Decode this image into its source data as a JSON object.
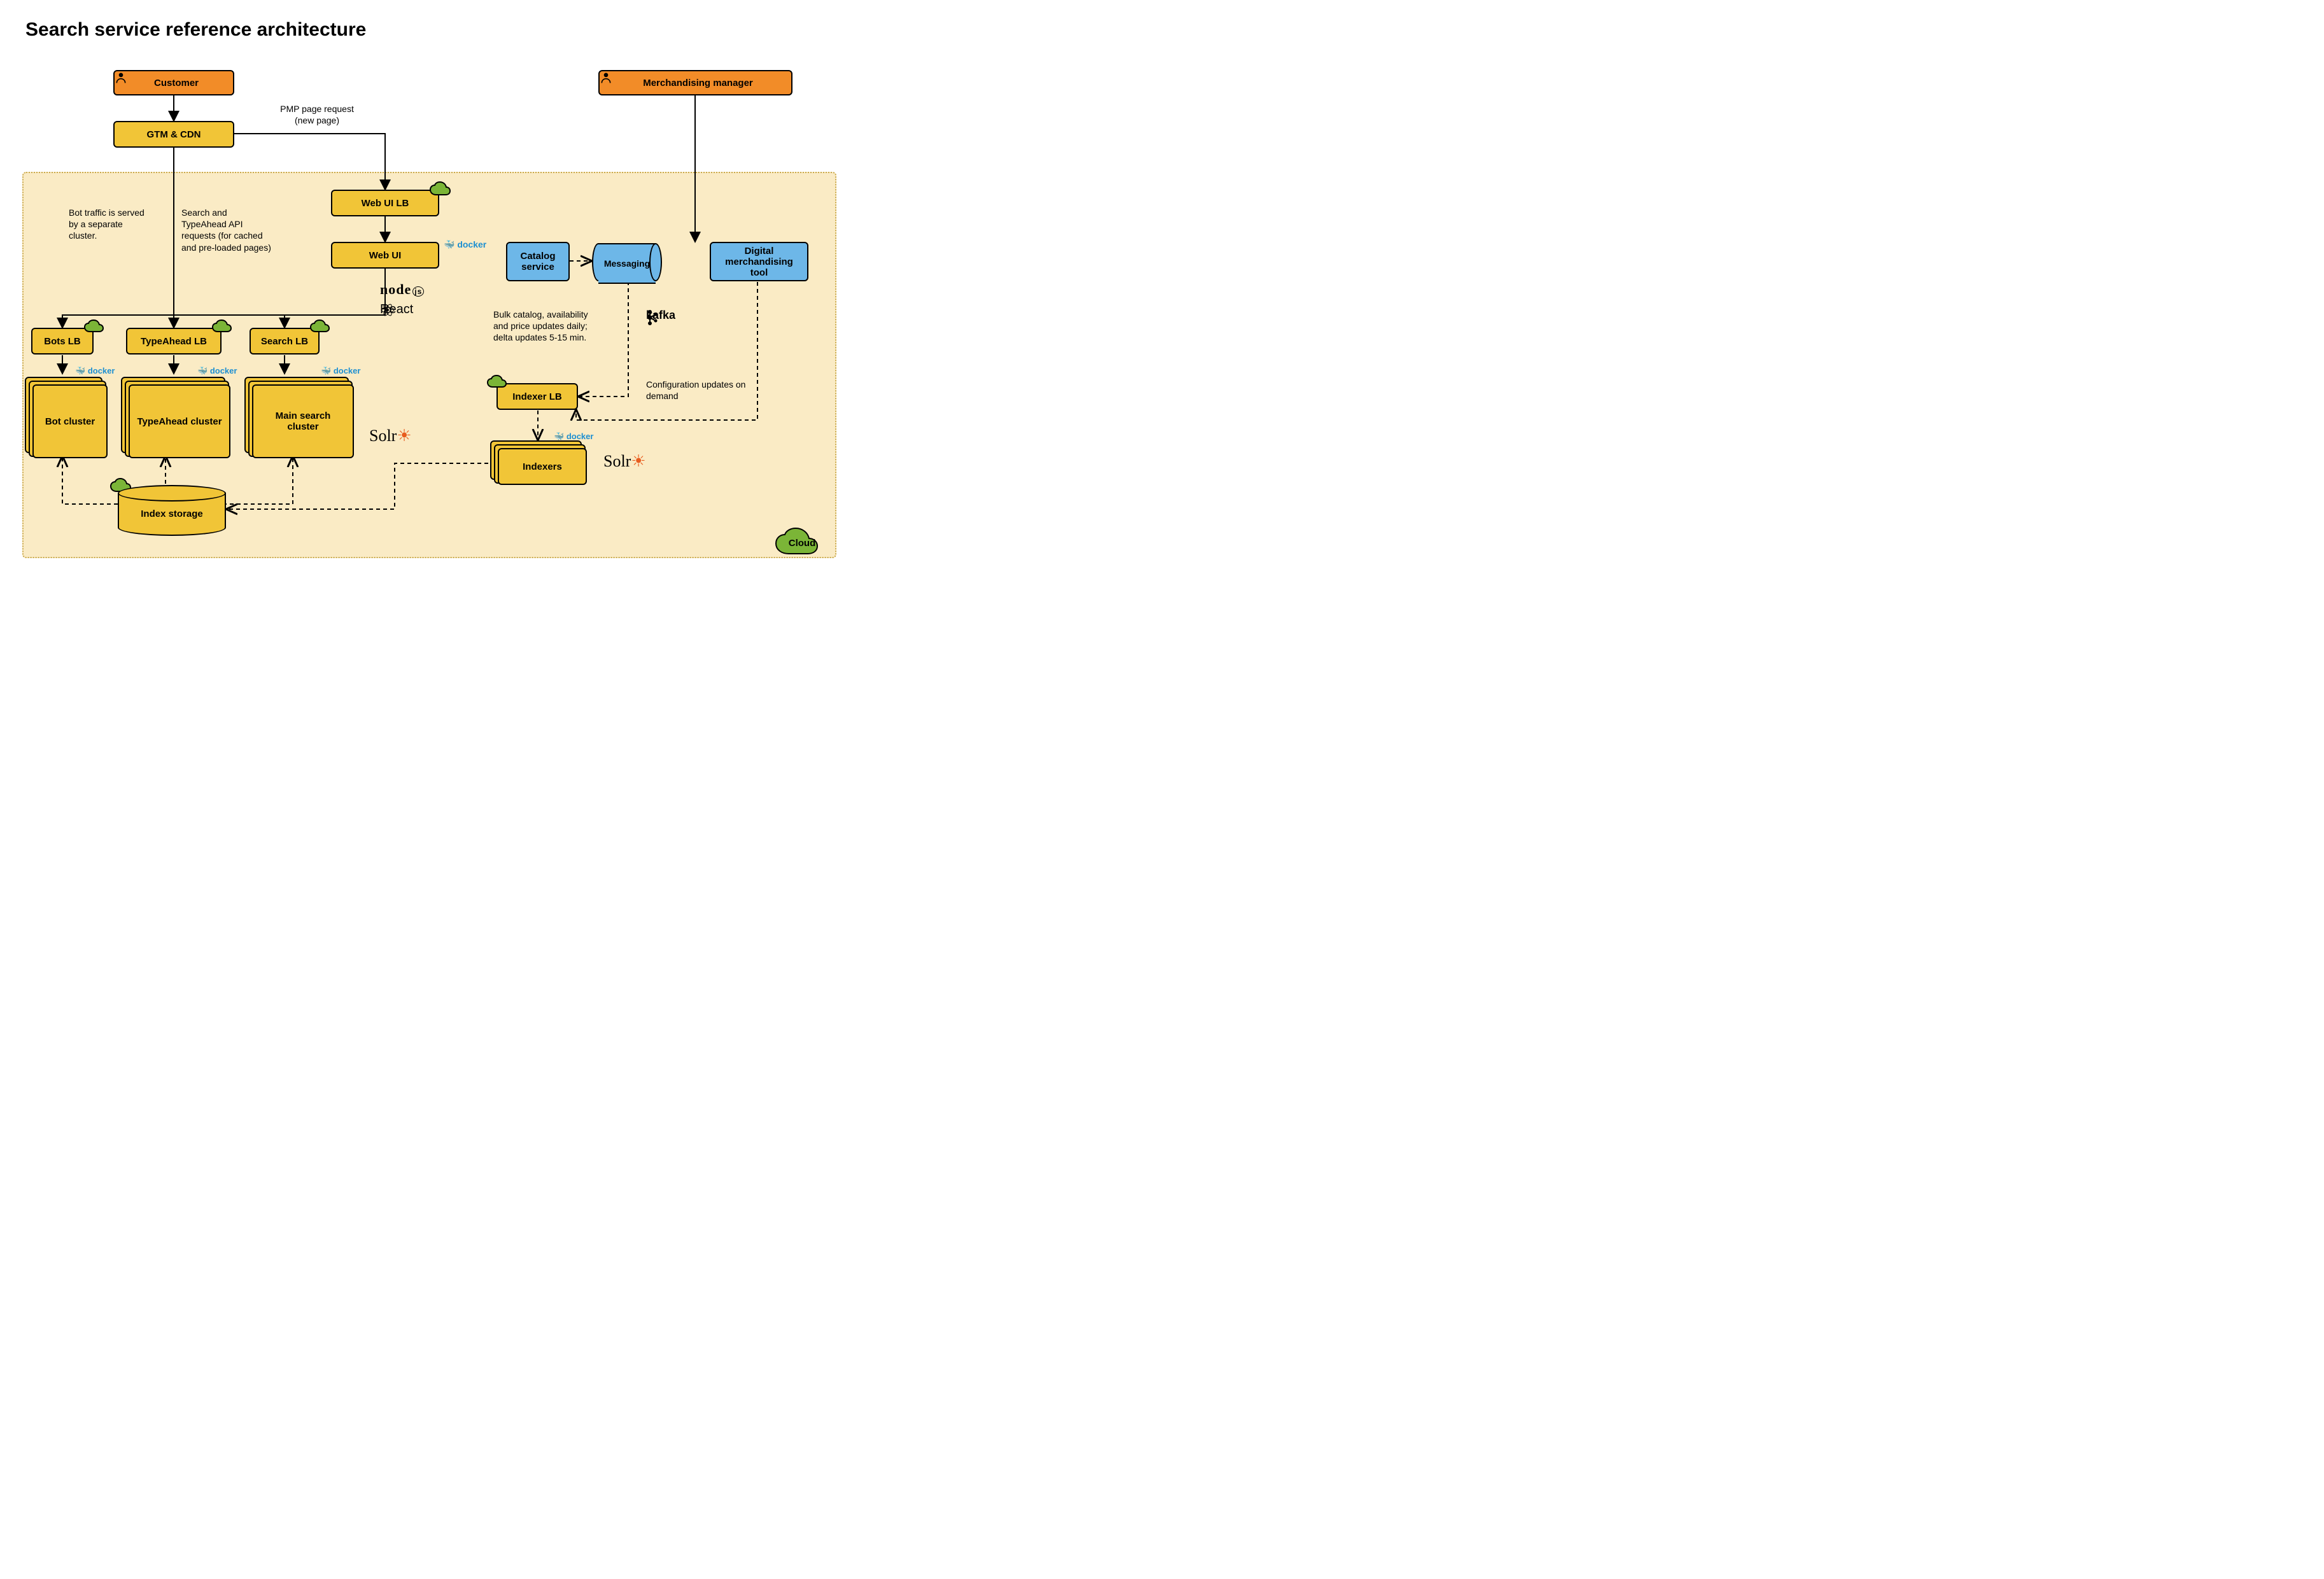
{
  "title": "Search service reference architecture",
  "actors": {
    "customer": "Customer",
    "merch_manager": "Merchandising manager"
  },
  "nodes": {
    "gtm_cdn": "GTM & CDN",
    "web_ui_lb": "Web UI LB",
    "web_ui": "Web UI",
    "bots_lb": "Bots LB",
    "typeahead_lb": "TypeAhead LB",
    "search_lb": "Search LB",
    "bot_cluster": "Bot cluster",
    "typeahead_cluster": "TypeAhead cluster",
    "main_search_cluster": "Main search cluster",
    "catalog_service": "Catalog service",
    "messaging": "Messaging",
    "digital_merch_tool": "Digital merchandising tool",
    "indexer_lb": "Indexer LB",
    "indexers": "Indexers",
    "index_storage": "Index storage",
    "cloud": "Cloud"
  },
  "notes": {
    "pmp": "PMP page request\n(new page)",
    "bot_traffic": "Bot traffic is served by a separate cluster.",
    "search_api": "Search and TypeAhead API requests (for cached and pre-loaded pages)",
    "bulk": "Bulk catalog, availability and price updates daily; delta updates 5-15 min.",
    "config": "Configuration updates on demand"
  },
  "logos": {
    "docker": "docker",
    "nodejs": "node",
    "react": "React",
    "solr": "Solr",
    "kafka": "kafka"
  }
}
